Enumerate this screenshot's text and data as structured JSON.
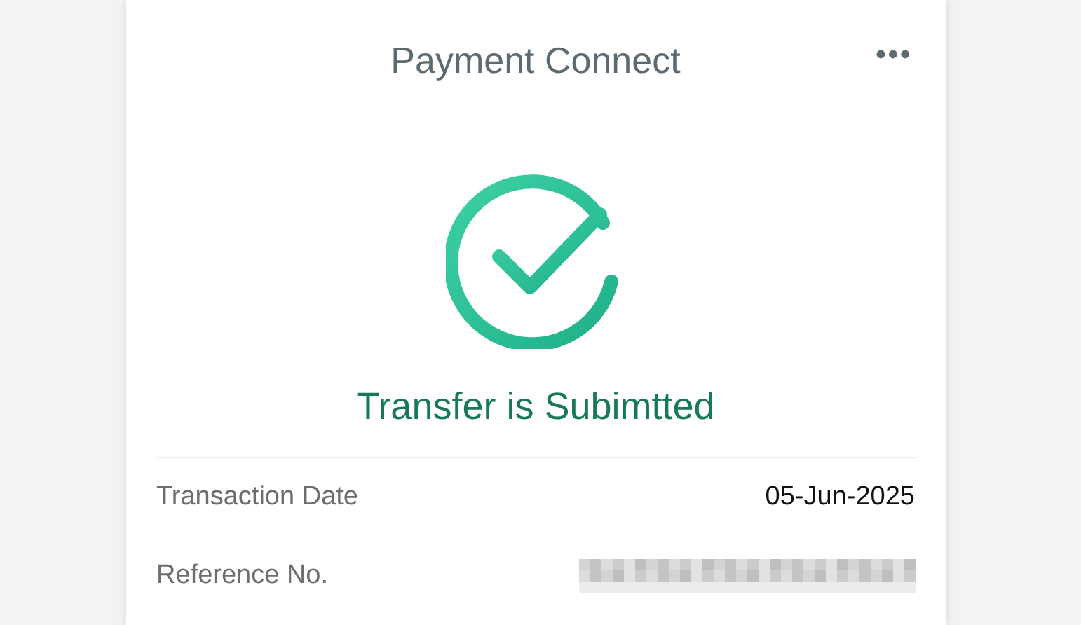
{
  "header": {
    "title": "Payment Connect",
    "menu": "•••"
  },
  "status": {
    "message": "Transfer is Subimtted"
  },
  "details": [
    {
      "kind": "text",
      "label": "Transaction Date",
      "value": "05-Jun-2025"
    },
    {
      "kind": "redacted",
      "label": "Reference No."
    }
  ]
}
